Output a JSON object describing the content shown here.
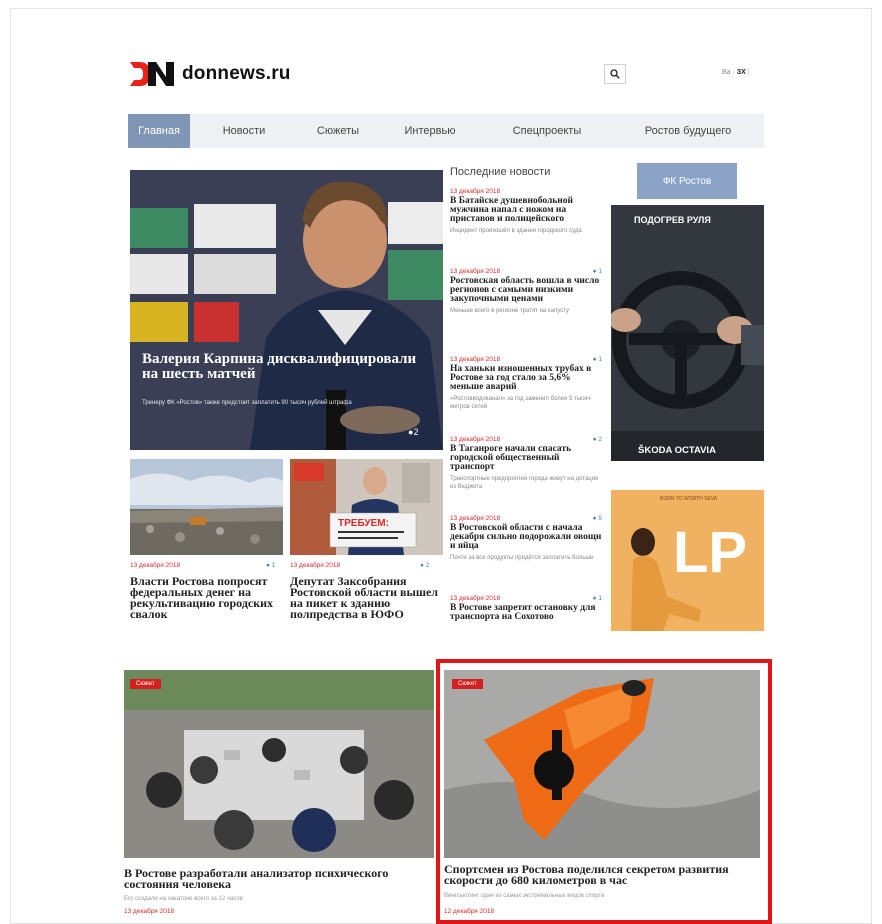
{
  "header": {
    "site_name": "donnews.ru",
    "logo_letters": "DN",
    "lang_prefix": "Ba ·",
    "lang_active": "ЗХ"
  },
  "nav": {
    "items": [
      "Главная",
      "Новости",
      "Сюжеты",
      "Интервью",
      "Спецпроекты",
      "Ростов будущего"
    ],
    "active_index": 0
  },
  "hero": {
    "title": "Валерия Карпина дисквалифицировали на шесть матчей",
    "subtitle": "Тренеру ФК «Ростов» также предстоит заплатить 90 тысяч рублей штрафа",
    "comments": "2"
  },
  "cards": [
    {
      "date": "13 декабря 2018",
      "comments": "1",
      "title": "Власти Ростова попросят федеральных денег на рекультивацию городских свалок"
    },
    {
      "date": "13 декабря 2018",
      "comments": "2",
      "title": "Депутат Заксобрания Ростовской области вышел на пикет к зданию полпредства в ЮФО",
      "protest_sign": "ТРЕБУЕМ:"
    }
  ],
  "news": {
    "heading": "Последние новости",
    "items": [
      {
        "date": "13 декабря 2018",
        "comments": "",
        "title": "В Батайске душевнобольной мужчина напал с ножом на приставов и полицейского",
        "lead": "Инцидент произошёл в здании городского суда"
      },
      {
        "date": "13 декабря 2018",
        "comments": "1",
        "title": "Ростовская область вошла в число регионов с самыми низкими закупочными ценами",
        "lead": "Меньше всего в регионе тратят на капусту"
      },
      {
        "date": "13 декабря 2018",
        "comments": "1",
        "title": "На ханьки изношенных трубах в Ростове за год стало за 5,6% меньше аварий",
        "lead": "«Ростовводоканал» за год заменил более 5 тысяч метров сетей"
      },
      {
        "date": "13 декабря 2018",
        "comments": "2",
        "title": "В Таганроге начали спасать городской общественный транспорт",
        "lead": "Транспортные предприятия города живут на дотации из бюджета"
      },
      {
        "date": "13 декабря 2018",
        "comments": "5",
        "title": "В Ростовской области с начала декабря сильно подорожали овощи и яйца",
        "lead": "Почти за все продукты придётся заплатить больше"
      },
      {
        "date": "13 декабря 2018",
        "comments": "1",
        "title": "В Ростове запретят остановку для транспорта на Сохотово",
        "lead": ""
      }
    ]
  },
  "sidebar": {
    "fk_button": "ФК Ростов",
    "ad1_top": "ПОДОГРЕВ РУЛЯ",
    "ad1_bottom": "ŠKODA OCTAVIA",
    "ad2_small": "BORN TO WORTH SEVA",
    "ad2_big": "LP"
  },
  "stories": [
    {
      "badge": "Сюжет",
      "title": "В Ростове разработали анализатор психического состояния человека",
      "lead": "Его создали на хакатоне всего за 12 часов",
      "date": "13 декабря 2018"
    },
    {
      "badge": "Сюжет",
      "title": "Спортсмен из Ростова поделился секретом развития скорости до 680 километров в час",
      "lead": "Вингсьютинг один из самых экстремальных видов спорта",
      "date": "12 декабря 2018"
    }
  ]
}
